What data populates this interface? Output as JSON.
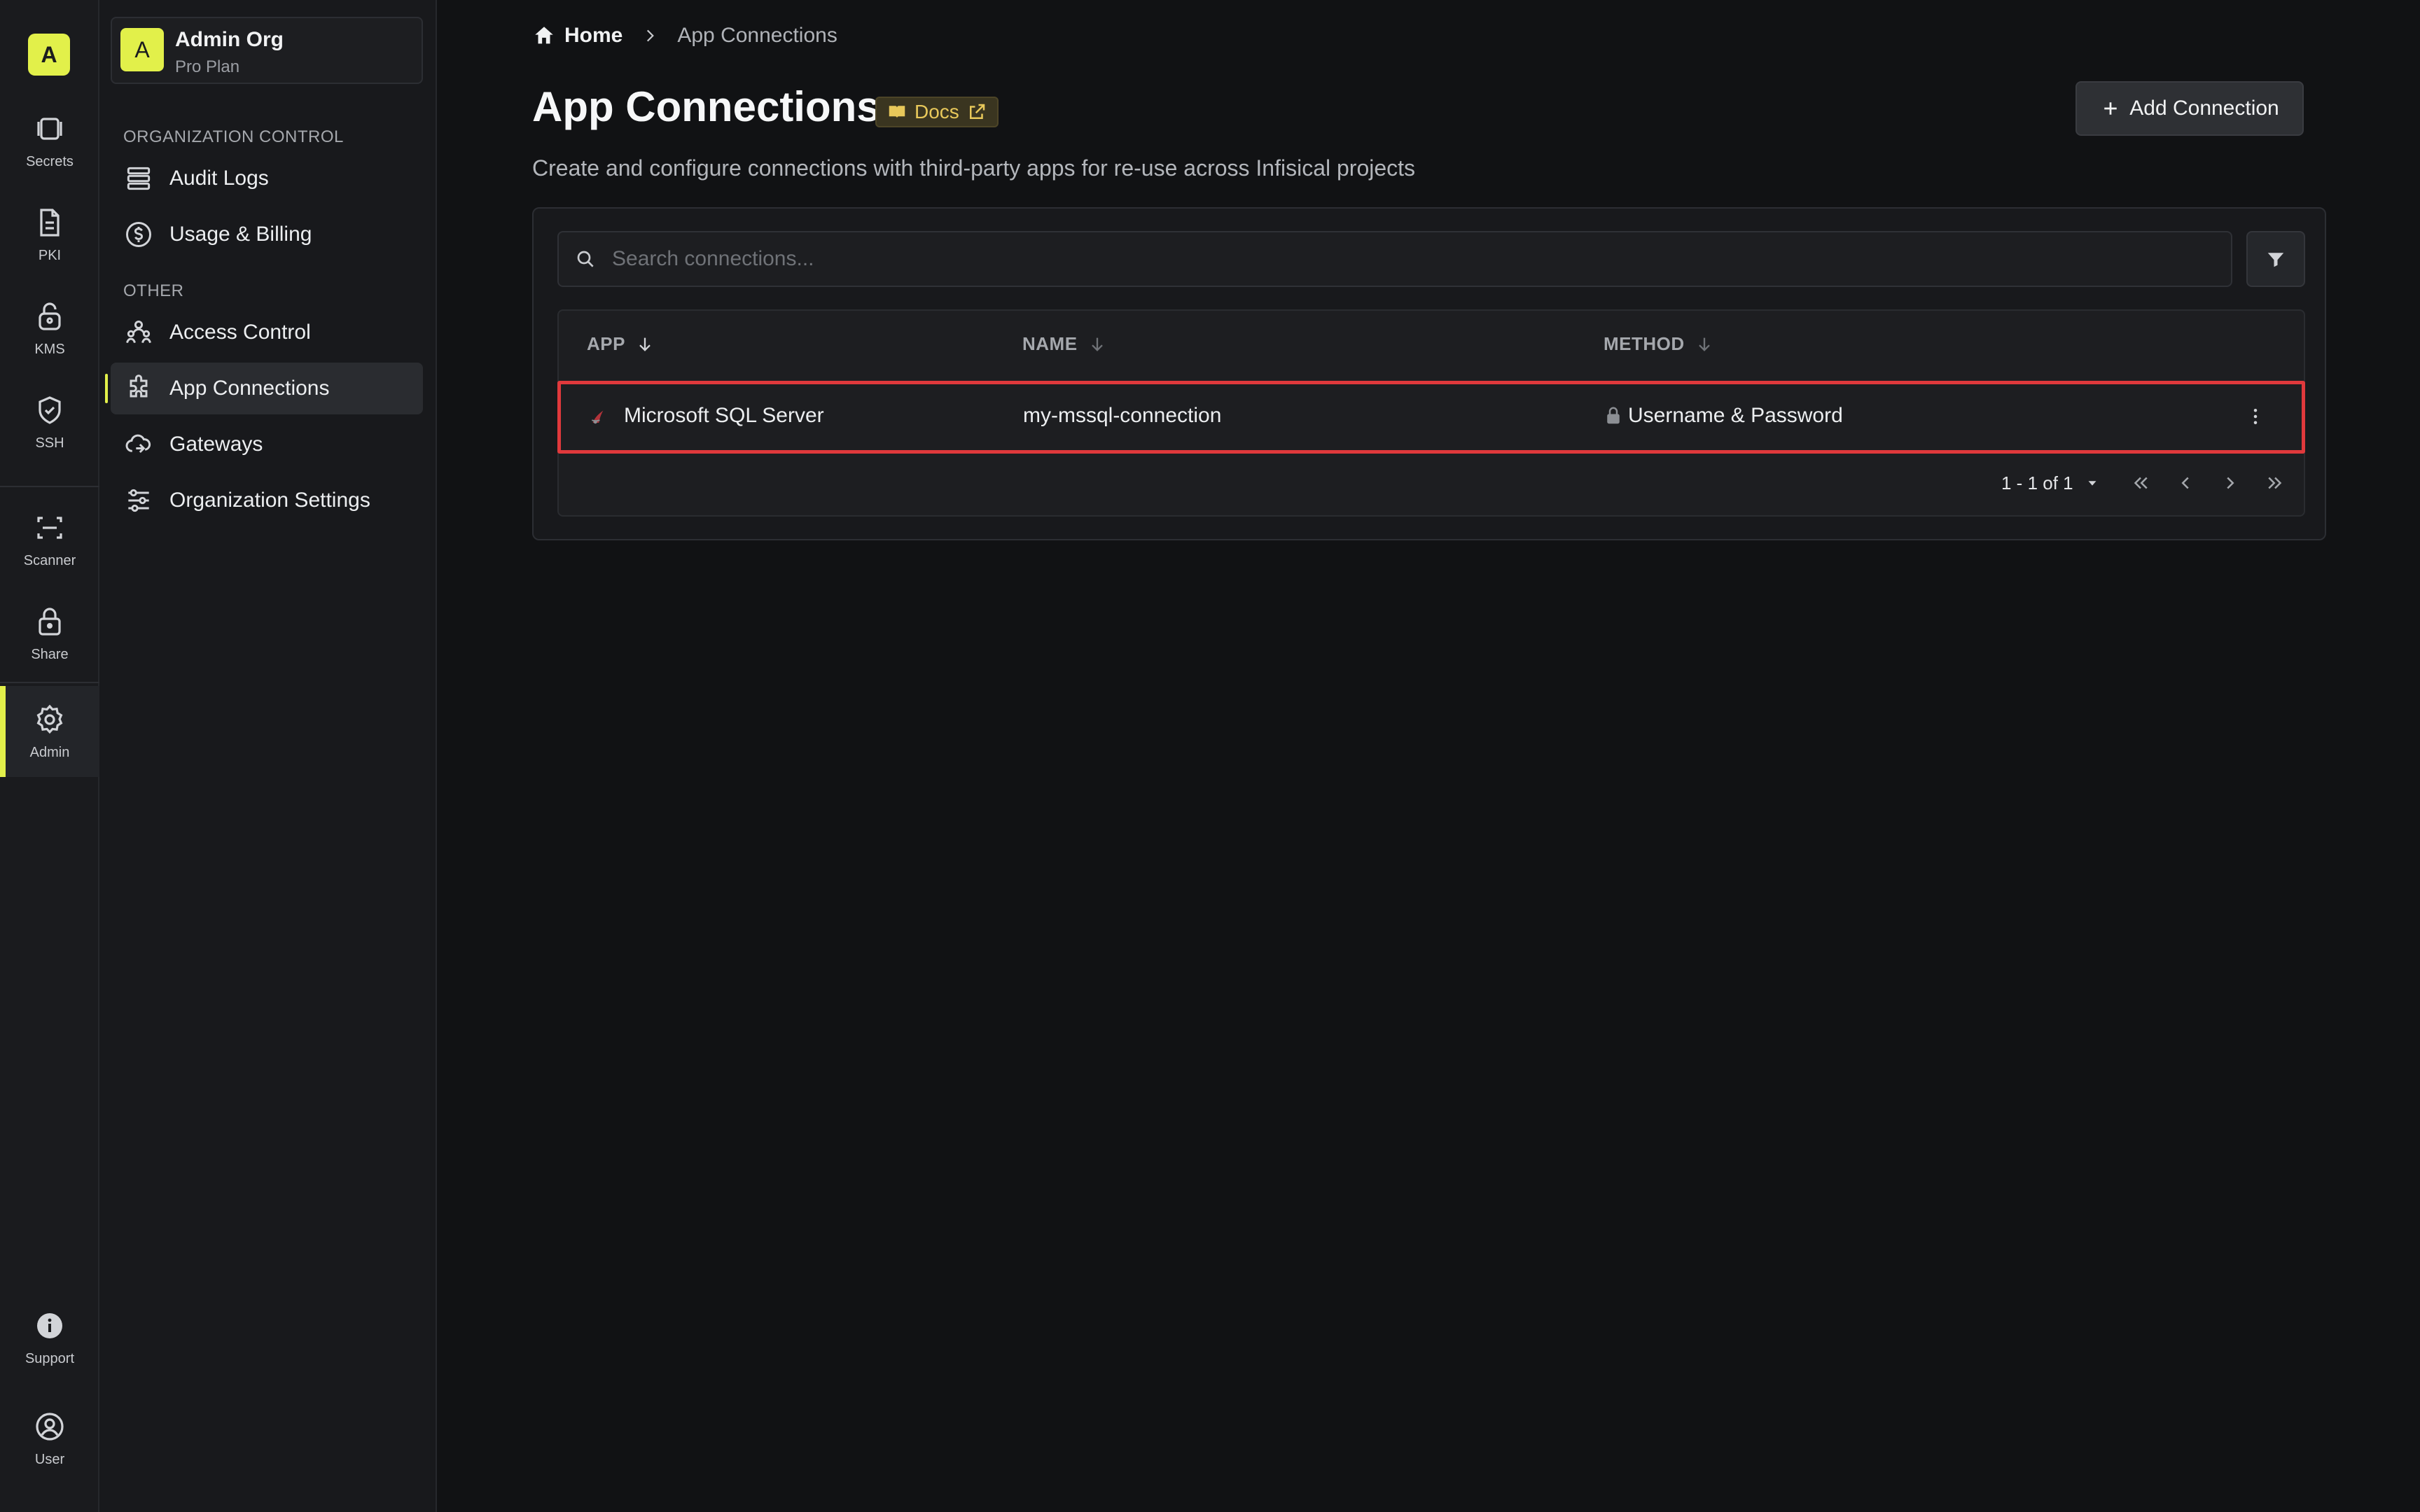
{
  "rail": {
    "logo": "A",
    "items": [
      {
        "label": "Secrets",
        "icon": "secrets-icon"
      },
      {
        "label": "PKI",
        "icon": "document-icon"
      },
      {
        "label": "KMS",
        "icon": "lock-key-icon"
      },
      {
        "label": "SSH",
        "icon": "shield-check-icon"
      },
      {
        "label": "Scanner",
        "icon": "scan-icon"
      },
      {
        "label": "Share",
        "icon": "lock-icon"
      },
      {
        "label": "Admin",
        "icon": "gear-icon"
      },
      {
        "label": "Support",
        "icon": "info-icon"
      },
      {
        "label": "User",
        "icon": "user-icon"
      }
    ]
  },
  "sidebar": {
    "org": {
      "avatar": "A",
      "name": "Admin Org",
      "plan": "Pro Plan"
    },
    "sections": [
      {
        "label": "ORGANIZATION CONTROL",
        "items": [
          {
            "label": "Audit Logs",
            "icon": "list-icon"
          },
          {
            "label": "Usage & Billing",
            "icon": "dollar-icon"
          }
        ]
      },
      {
        "label": "OTHER",
        "items": [
          {
            "label": "Access Control",
            "icon": "users-icon"
          },
          {
            "label": "App Connections",
            "icon": "puzzle-icon",
            "active": true
          },
          {
            "label": "Gateways",
            "icon": "cloud-icon"
          },
          {
            "label": "Organization Settings",
            "icon": "sliders-icon"
          }
        ]
      }
    ]
  },
  "breadcrumb": {
    "home": "Home",
    "current": "App Connections"
  },
  "page": {
    "title": "App Connections",
    "docs_label": "Docs",
    "subtitle": "Create and configure connections with third-party apps for re-use across Infisical projects",
    "add_button": "Add Connection"
  },
  "search": {
    "placeholder": "Search connections..."
  },
  "table": {
    "columns": [
      "APP",
      "NAME",
      "METHOD"
    ],
    "rows": [
      {
        "app": "Microsoft SQL Server",
        "name": "my-mssql-connection",
        "method": "Username & Password"
      }
    ]
  },
  "pagination": {
    "range": "1 - 1 of 1"
  },
  "colors": {
    "accent": "#e2f04a",
    "highlight": "#e0393c",
    "background": "#111214"
  }
}
